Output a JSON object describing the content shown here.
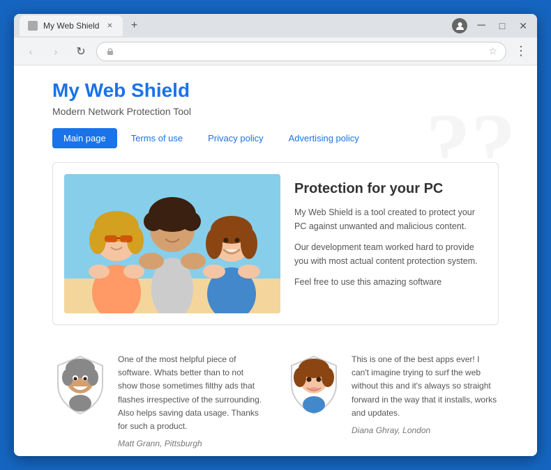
{
  "browser": {
    "tab_title": "My Web Shield",
    "address": "",
    "back_btn": "‹",
    "forward_btn": "›",
    "refresh_btn": "↻",
    "home_btn": "⌂"
  },
  "page": {
    "title": "My Web Shield",
    "subtitle": "Modern Network Protection Tool",
    "watermark": "??",
    "nav": {
      "tabs": [
        {
          "label": "Main page",
          "active": true
        },
        {
          "label": "Terms of use",
          "active": false
        },
        {
          "label": "Privacy policy",
          "active": false
        },
        {
          "label": "Advertising policy",
          "active": false
        }
      ]
    },
    "card": {
      "title": "Protection for your PC",
      "desc1": "My Web Shield is a tool created to protect your PC against unwanted and malicious content.",
      "desc2": "Our development team worked hard to provide you with most actual content protection system.",
      "desc3": "Feel free to use this amazing software"
    },
    "testimonials": [
      {
        "text": "One of the most helpful piece of software. Whats better than to not show those sometimes filthy ads that flashes irrespective of the surrounding. Also helps saving data usage. Thanks for such a product.",
        "author": "Matt Grann, Pittsburgh"
      },
      {
        "text": "This is one of the best apps ever! I can't imagine trying to surf the web without this and it's always so straight forward in the way that it installs, works and updates.",
        "author": "Diana Ghray, London"
      }
    ]
  }
}
